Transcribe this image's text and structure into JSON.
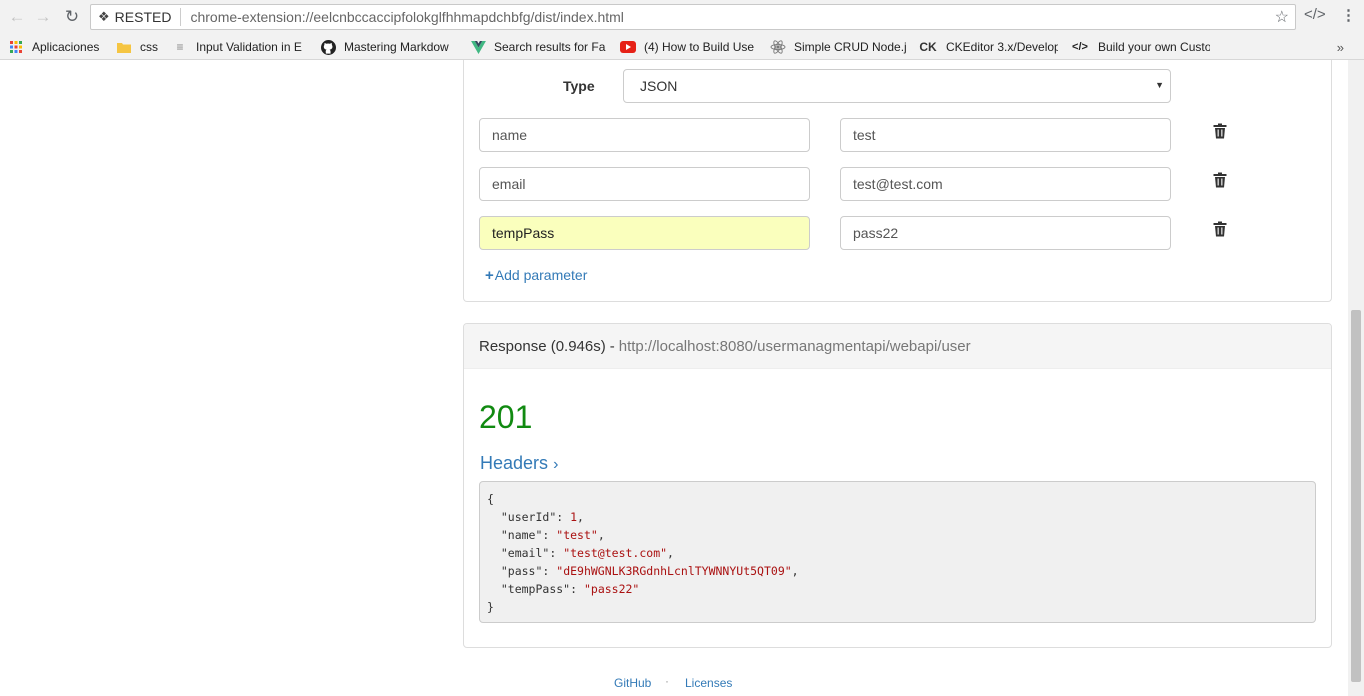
{
  "browser": {
    "tab_chip": "RESTED",
    "url": "chrome-extension://eelcnbccaccipfolokglfhhmapdchbfg/dist/index.html"
  },
  "bookmarks": [
    {
      "label": "Aplicaciones",
      "icon": "apps-grid-icon"
    },
    {
      "label": "css",
      "icon": "folder-icon"
    },
    {
      "label": "Input Validation in E",
      "icon": "page-icon"
    },
    {
      "label": "Mastering Markdow",
      "icon": "github-icon"
    },
    {
      "label": "Search results for Fa",
      "icon": "vue-icon"
    },
    {
      "label": "(4) How to Build Use",
      "icon": "youtube-icon"
    },
    {
      "label": "Simple CRUD Node.j",
      "icon": "react-icon"
    },
    {
      "label": "CKEditor 3.x/Develop",
      "icon": "ckeditor-icon"
    },
    {
      "label": "Build your own Custo",
      "icon": "code-icon"
    }
  ],
  "colors": {
    "accent": "#337ab7",
    "success": "#118a11",
    "autofill": "#faffbd",
    "string": "#aa1111"
  },
  "request": {
    "type_label": "Type",
    "type_value": "JSON",
    "params": [
      {
        "key": "name",
        "value": "test",
        "autofilled": false
      },
      {
        "key": "email",
        "value": "test@test.com",
        "autofilled": false
      },
      {
        "key": "tempPass",
        "value": "pass22",
        "autofilled": true
      }
    ],
    "add_parameter": "Add parameter"
  },
  "response": {
    "label": "Response (0.946s)",
    "separator": "-",
    "url": "http://localhost:8080/usermanagmentapi/webapi/user",
    "status": "201",
    "headers_label": "Headers",
    "body": {
      "open": "{",
      "close": "}",
      "fields": [
        {
          "key": "\"userId\"",
          "value": "1",
          "kind": "number",
          "trail": ","
        },
        {
          "key": "\"name\"",
          "value": "\"test\"",
          "kind": "string",
          "trail": ","
        },
        {
          "key": "\"email\"",
          "value": "\"test@test.com\"",
          "kind": "string",
          "trail": ","
        },
        {
          "key": "\"pass\"",
          "value": "\"dE9hWGNLK3RGdnhLcnlTYWNNYUt5QT09\"",
          "kind": "string",
          "trail": ","
        },
        {
          "key": "\"tempPass\"",
          "value": "\"pass22\"",
          "kind": "string",
          "trail": ""
        }
      ]
    }
  },
  "footer": {
    "github": "GitHub",
    "dot": "·",
    "licenses": "Licenses"
  }
}
